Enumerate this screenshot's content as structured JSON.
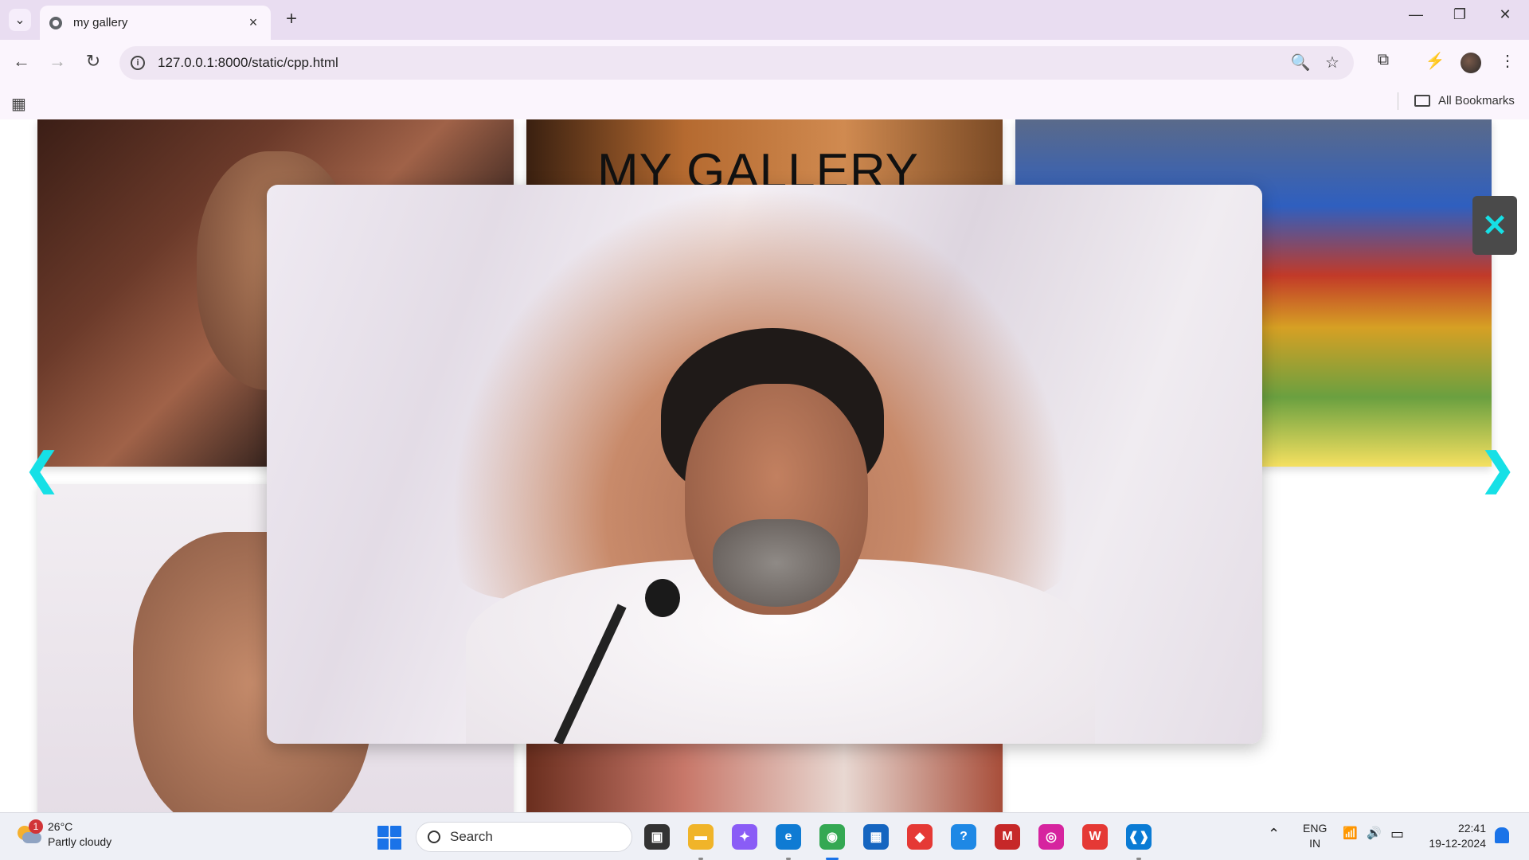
{
  "browser": {
    "tab_title": "my gallery",
    "tab_close": "×",
    "new_tab": "+",
    "url": "127.0.0.1:8000/static/cpp.html",
    "bookmarks_label": "All Bookmarks",
    "window_controls": {
      "minimize": "—",
      "maximize": "❐",
      "close": "✕"
    },
    "nav": {
      "back": "←",
      "forward": "→",
      "reload": "↻"
    },
    "icons": {
      "zoom": "🔍",
      "star": "☆",
      "extensions": "⧉",
      "performance": "⚡",
      "menu": "⋮",
      "apps": "▦",
      "tab_menu": "⌄",
      "info": "i"
    }
  },
  "page": {
    "gallery_title": "MY GALLERY",
    "prev_arrow": "❮",
    "next_arrow": "❯",
    "close_symbol": "✕"
  },
  "taskbar": {
    "weather": {
      "temperature": "26°C",
      "condition": "Partly cloudy",
      "badge": "1"
    },
    "search_placeholder": "Search",
    "language": {
      "line1": "ENG",
      "line2": "IN"
    },
    "clock": {
      "time": "22:41",
      "date": "19-12-2024"
    },
    "apps": [
      {
        "name": "task-view",
        "glyph": "▣",
        "color": "#333333"
      },
      {
        "name": "file-explorer",
        "glyph": "▬",
        "color": "#f0b429"
      },
      {
        "name": "copilot",
        "glyph": "✦",
        "color": "#8a5cf6"
      },
      {
        "name": "edge",
        "glyph": "e",
        "color": "#0f7bd3"
      },
      {
        "name": "chrome",
        "glyph": "◉",
        "color": "#34a853"
      },
      {
        "name": "store",
        "glyph": "▦",
        "color": "#1565c0"
      },
      {
        "name": "red-app",
        "glyph": "◆",
        "color": "#e53935"
      },
      {
        "name": "help",
        "glyph": "?",
        "color": "#1e88e5"
      },
      {
        "name": "mcafee",
        "glyph": "M",
        "color": "#c62828"
      },
      {
        "name": "instagram",
        "glyph": "◎",
        "color": "#d6249f"
      },
      {
        "name": "wps-office",
        "glyph": "W",
        "color": "#e53935"
      },
      {
        "name": "vscode",
        "glyph": "❰❱",
        "color": "#0a7bd4"
      }
    ],
    "tray": {
      "chevron": "⌃",
      "wifi": "📶",
      "volume": "🔊",
      "battery": "▭"
    }
  }
}
